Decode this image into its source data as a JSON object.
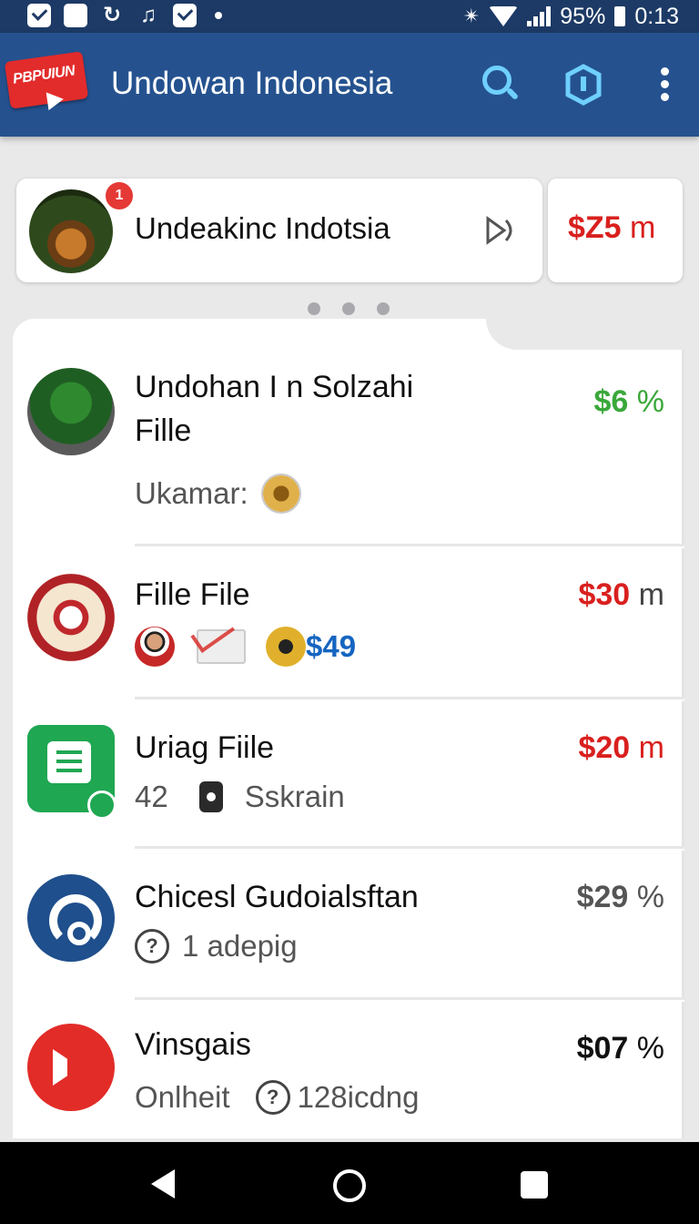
{
  "status_bar": {
    "battery": "95%",
    "time": "0:13"
  },
  "app_bar": {
    "logo_text": "PBPUIUN",
    "title": "Undowan Indonesia"
  },
  "top_card": {
    "badge": "1",
    "title": "Undeakinc Indotsia",
    "amount": "$Z5",
    "amount_unit": "m"
  },
  "rows": [
    {
      "name_line1": "Undohan I n Solzahi",
      "name_line2": "Fille",
      "sub": "Ukamar:",
      "amount": "$6",
      "unit": "%",
      "amount_color": "#3aa83a"
    },
    {
      "name": "Fille File",
      "sub_amount": "$49",
      "amount": "$30",
      "unit": "m",
      "amount_color": "#d9201e"
    },
    {
      "name": "Uriag Fiile",
      "sub_num": "42",
      "sub": "Sskrain",
      "amount": "$20",
      "unit": "m",
      "amount_color": "#d9201e"
    },
    {
      "name": "Chicesl Gudoialsftan",
      "sub": "1 adepig",
      "amount": "$29",
      "unit": "%",
      "amount_color": "#555555"
    },
    {
      "name": "Vinsgais",
      "sub_left": "Onlheit",
      "sub": "128icdng",
      "amount": "$07",
      "unit": "%",
      "amount_color": "#111111"
    }
  ]
}
